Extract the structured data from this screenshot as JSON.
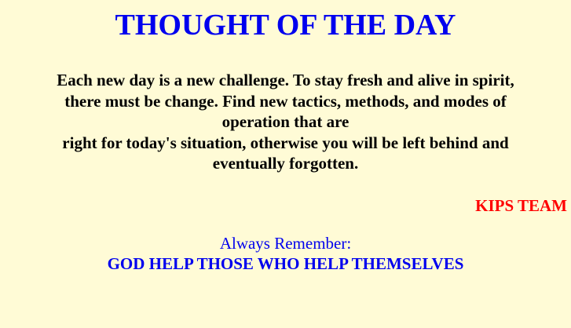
{
  "page": {
    "title": "THOUGHT OF THE DAY",
    "quote_lines": [
      "Each new day is a new challenge. To stay fresh and alive in spirit,",
      "there must be change. Find new tactics, methods, and modes of",
      "operation that are",
      "right for today's situation, otherwise you will be left behind and",
      "eventually forgotten."
    ],
    "signature": "KIPS TEAM",
    "remember_label": "Always Remember:",
    "remember_motto": "GOD HELP THOSE WHO HELP THEMSELVES"
  },
  "colors": {
    "background": "#fffbd6",
    "title": "#0000ee",
    "quote": "#000000",
    "signature": "#ff0000",
    "motto": "#0000ee"
  }
}
